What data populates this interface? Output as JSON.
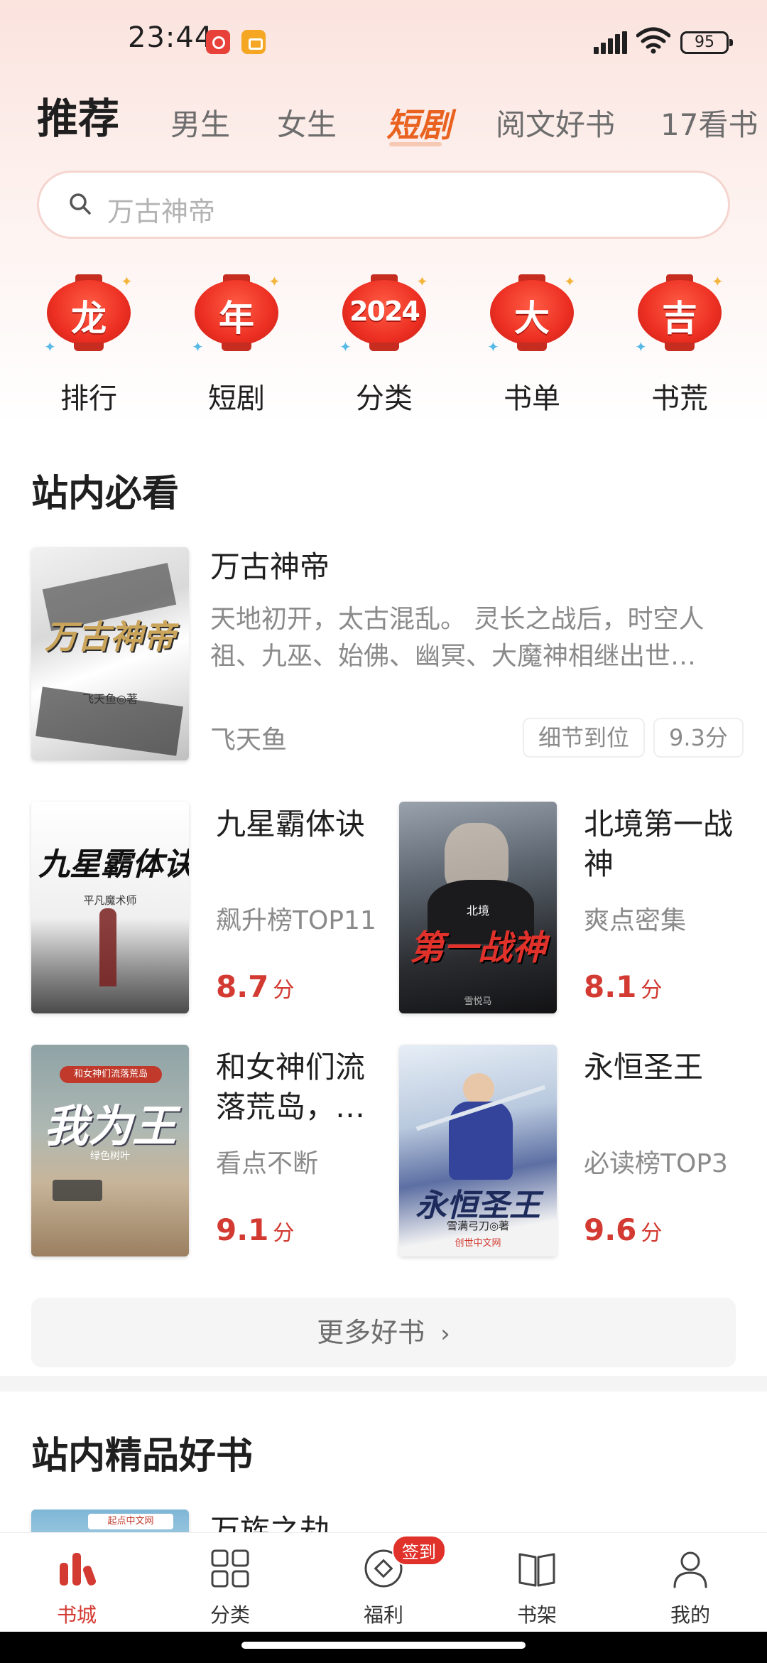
{
  "status_bar": {
    "time": "23:44",
    "battery": "95"
  },
  "tabs": {
    "main": "推荐",
    "items": [
      "男生",
      "女生",
      "短剧",
      "阅文好书",
      "17看书"
    ],
    "active": "短剧"
  },
  "search": {
    "placeholder": "万古神帝"
  },
  "quick_links": [
    {
      "lantern_char": "龙",
      "label": "排行"
    },
    {
      "lantern_char": "年",
      "label": "短剧"
    },
    {
      "lantern_char": "2024",
      "label": "分类"
    },
    {
      "lantern_char": "大",
      "label": "书单"
    },
    {
      "lantern_char": "吉",
      "label": "书荒"
    }
  ],
  "section_must_read": {
    "title": "站内必看",
    "featured": {
      "title": "万古神帝",
      "description": "天地初开，太古混乱。 灵长之战后，时空人祖、九巫、始佛、幽冥、大魔神相继出世…",
      "author": "飞天鱼",
      "tag": "细节到位",
      "score": "9.3分",
      "cover_title": "万古神帝",
      "cover_author": "飞天鱼◎著"
    },
    "books": [
      {
        "title": "九星霸体诀",
        "tag": "飙升榜TOP11",
        "score": "8.7",
        "unit": "分",
        "cover_title": "九星霸体诀",
        "cover_author": "平凡魔术师"
      },
      {
        "title": "北境第一战神",
        "tag": "爽点密集",
        "score": "8.1",
        "unit": "分",
        "cover_title": "第一战神",
        "cover_sub": "北境",
        "cover_author": "雪悦马"
      },
      {
        "title": "和女神们流落荒岛，…",
        "tag": "看点不断",
        "score": "9.1",
        "unit": "分",
        "cover_title": "我为王",
        "cover_sub": "和女神们流落荒岛",
        "cover_author": "绿色树叶"
      },
      {
        "title": "永恒圣王",
        "tag": "必读榜TOP3",
        "score": "9.6",
        "unit": "分",
        "cover_title": "永恒圣王",
        "cover_author": "雪满弓刀◎著",
        "cover_brand": "创世中文网"
      }
    ],
    "more_label": "更多好书"
  },
  "section_quality": {
    "title": "站内精品好书",
    "first_book": {
      "title": "万族之劫",
      "cover_brand": "起点中文网"
    }
  },
  "bottom_nav": [
    {
      "label": "书城",
      "icon": "chart-bars-icon",
      "active": true
    },
    {
      "label": "分类",
      "icon": "grid-icon",
      "active": false
    },
    {
      "label": "福利",
      "icon": "coin-icon",
      "active": false,
      "badge": "签到"
    },
    {
      "label": "书架",
      "icon": "open-book-icon",
      "active": false
    },
    {
      "label": "我的",
      "icon": "person-icon",
      "active": false
    }
  ],
  "colors": {
    "accent": "#d23a32",
    "tab_active": "#e9621f",
    "lantern": "#ec2f22"
  }
}
